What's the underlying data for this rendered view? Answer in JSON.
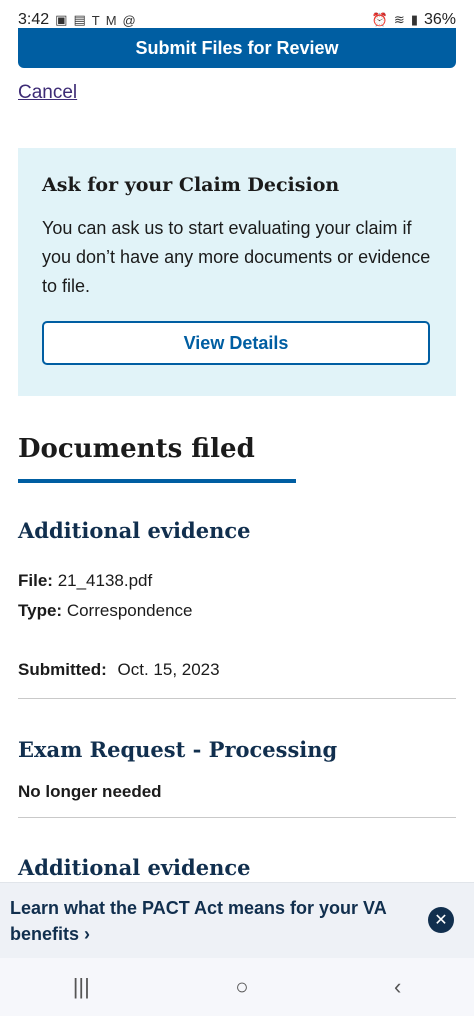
{
  "status_bar": {
    "time": "3:42",
    "battery": "36%",
    "left_icons": [
      "gallery-icon",
      "photo-icon",
      "t-mobile-icon",
      "gmail-icon",
      "at-icon"
    ],
    "right_icons": [
      "alarm-icon",
      "wifi-icon",
      "signal-icon"
    ]
  },
  "actions": {
    "submit_label": "Submit Files for Review",
    "cancel_label": "Cancel"
  },
  "claim_box": {
    "title": "Ask for your Claim Decision",
    "body": "You can ask us to start evaluating your claim if you don’t have any more documents or evidence to file.",
    "button_label": "View Details"
  },
  "documents": {
    "heading": "Documents filed",
    "items": [
      {
        "title": "Additional evidence",
        "file_label": "File:",
        "file_value": "21_4138.pdf",
        "type_label": "Type:",
        "type_value": "Correspondence",
        "submitted_label": "Submitted:",
        "submitted_value": "Oct. 15, 2023"
      },
      {
        "title": "Exam Request - Processing",
        "status": "No longer needed"
      },
      {
        "title": "Additional evidence"
      }
    ]
  },
  "banner": {
    "text": "Learn what the PACT Act means for your VA benefits",
    "chevron": "›"
  },
  "nav": {
    "recents": "|||",
    "home": "○",
    "back": "‹"
  },
  "colors": {
    "primary": "#005ea2",
    "info_bg": "#e1f3f8",
    "heading_dark": "#112f4e",
    "link": "#3d2b75"
  }
}
